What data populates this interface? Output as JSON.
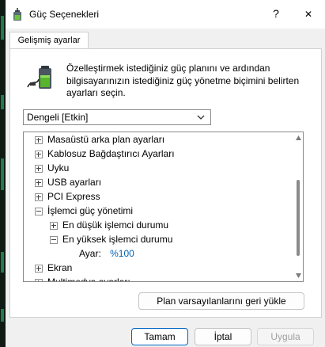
{
  "window": {
    "title": "Güç Seçenekleri",
    "help": "?",
    "close": "✕"
  },
  "tab": {
    "label": "Gelişmiş ayarlar"
  },
  "description": "Özelleştirmek istediğiniz güç planını ve ardından bilgisayarınızın istediğiniz güç yönetme biçimini belirten ayarları seçin.",
  "plan_select": {
    "value": "Dengeli [Etkin]"
  },
  "tree": {
    "items": [
      {
        "label": "Masaüstü arka plan ayarları"
      },
      {
        "label": "Kablosuz Bağdaştırıcı Ayarları"
      },
      {
        "label": "Uyku"
      },
      {
        "label": "USB ayarları"
      },
      {
        "label": "PCI Express"
      },
      {
        "label": "İşlemci güç yönetimi"
      },
      {
        "label": "En düşük işlemci durumu"
      },
      {
        "label": "En yüksek işlemci durumu"
      },
      {
        "label": "Ayar:",
        "value": "%100"
      },
      {
        "label": "Ekran"
      },
      {
        "label": "Multimedya ayarları"
      }
    ]
  },
  "restore_button": "Plan varsayılanlarını geri yükle",
  "buttons": {
    "ok": "Tamam",
    "cancel": "İptal",
    "apply": "Uygula"
  },
  "colors": {
    "link_value": "#0063b1",
    "default_border": "#0067c0"
  }
}
